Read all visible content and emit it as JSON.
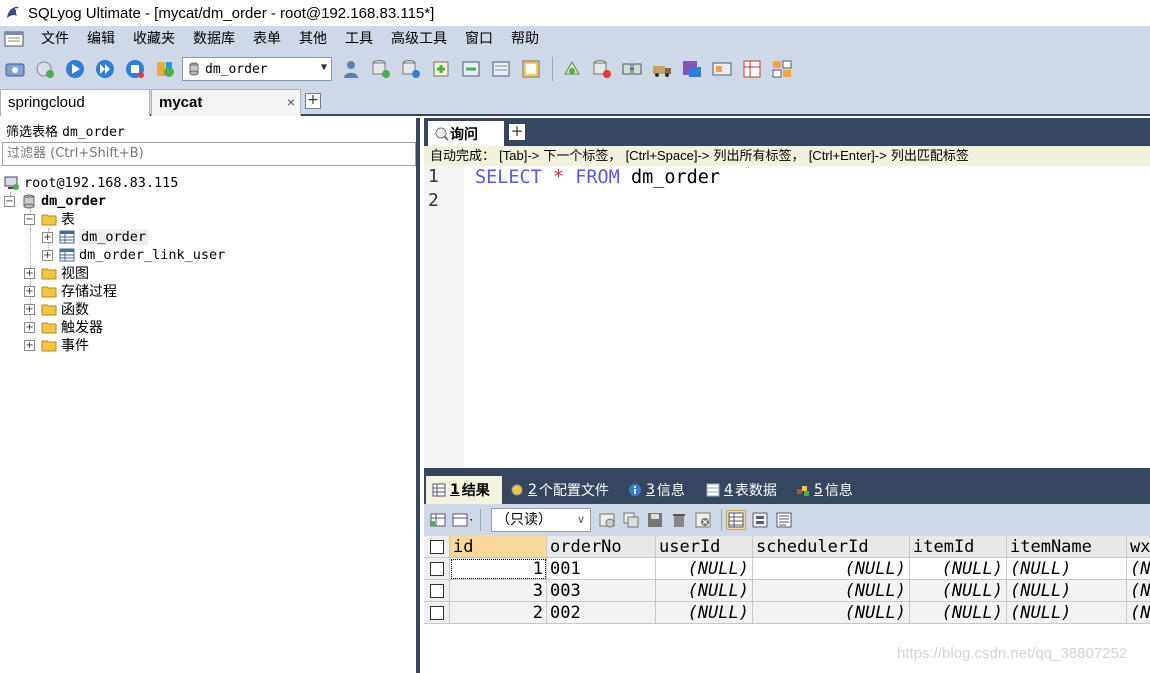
{
  "window": {
    "title": "SQLyog Ultimate - [mycat/dm_order - root@192.168.83.115*]"
  },
  "menu": [
    "文件",
    "编辑",
    "收藏夹",
    "数据库",
    "表单",
    "其他",
    "工具",
    "高级工具",
    "窗口",
    "帮助"
  ],
  "toolbar": {
    "db_selector": "dm_order"
  },
  "connections": {
    "tabs": [
      "springcloud",
      "mycat"
    ],
    "active": "mycat",
    "close": "×",
    "add": "+"
  },
  "filter": {
    "label": "筛选表格",
    "table": "dm_order",
    "placeholder": "过滤器 (Ctrl+Shift+B)"
  },
  "tree": {
    "server": "root@192.168.83.115",
    "database": "dm_order",
    "tables_folder": "表",
    "tables": [
      "dm_order",
      "dm_order_link_user"
    ],
    "folders": [
      "视图",
      "存储过程",
      "函数",
      "触发器",
      "事件"
    ],
    "expand_sign": "+",
    "collapse_sign": "−"
  },
  "query": {
    "tab_label": "询问",
    "add": "+",
    "hint_prefix": "自动完成：",
    "hint_k1": "[Tab]->",
    "hint_t1": "下一个标签，",
    "hint_k2": "[Ctrl+Space]->",
    "hint_t2": "列出所有标签，",
    "hint_k3": "[Ctrl+Enter]->",
    "hint_t3": "列出匹配标签",
    "line_numbers": [
      "1",
      "2"
    ],
    "sql": {
      "kw1": "SELECT",
      "star": "*",
      "kw2": "FROM",
      "table": "dm_order"
    }
  },
  "results": {
    "tabs": [
      {
        "num": "1",
        "label": "结果"
      },
      {
        "num": "2",
        "label": "个配置文件"
      },
      {
        "num": "3",
        "label": "信息"
      },
      {
        "num": "4",
        "label": "表数据"
      },
      {
        "num": "5",
        "label": "信息"
      }
    ],
    "mode": "（只读）",
    "columns": [
      "id",
      "orderNo",
      "userId",
      "schedulerId",
      "itemId",
      "itemName",
      "wx"
    ],
    "rows": [
      [
        "1",
        "001",
        "(NULL)",
        "(NULL)",
        "(NULL)",
        "(NULL)",
        "(N"
      ],
      [
        "3",
        "003",
        "(NULL)",
        "(NULL)",
        "(NULL)",
        "(NULL)",
        "(N"
      ],
      [
        "2",
        "002",
        "(NULL)",
        "(NULL)",
        "(NULL)",
        "(NULL)",
        "(N"
      ]
    ]
  },
  "watermark": "https://blog.csdn.net/qq_38807252",
  "colors": {
    "frame": "#36465f",
    "toolbar": "#cfd8e6",
    "keyword": "#5a5ae0",
    "operator": "#c83232",
    "header_highlight": "#f9d99a"
  }
}
